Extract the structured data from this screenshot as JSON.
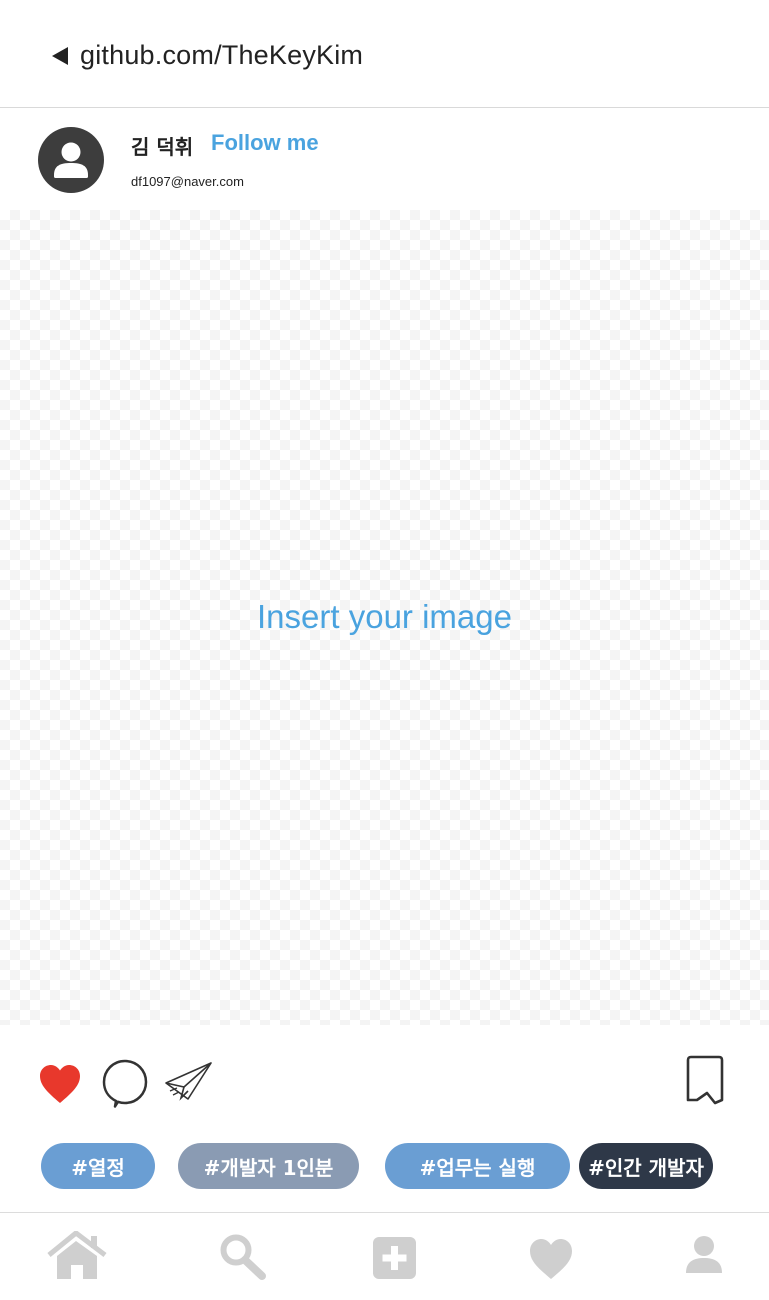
{
  "header": {
    "url": "github.com/TheKeyKim",
    "back_icon": "back-arrow-icon"
  },
  "profile": {
    "name": "김 덕휘",
    "follow_label": "Follow me",
    "email": "df1097@naver.com",
    "avatar_icon": "user-avatar-icon"
  },
  "post": {
    "image_placeholder": "Insert your image"
  },
  "actions": {
    "like_icon": "heart-icon",
    "comment_icon": "comment-icon",
    "share_icon": "paper-plane-icon",
    "bookmark_icon": "bookmark-icon",
    "like_color": "#e8382c"
  },
  "tags": [
    {
      "label": "#열정",
      "color": "#6a9ed3"
    },
    {
      "label": "#개발자 1인분",
      "color": "#8a9bb3"
    },
    {
      "label": "#업무는 실행",
      "color": "#6a9ed3"
    },
    {
      "label": "#인간 개발자",
      "color": "#2e3848"
    }
  ],
  "nav": {
    "items": [
      "home-icon",
      "search-icon",
      "add-icon",
      "heart-icon",
      "profile-icon"
    ],
    "color": "#cfcfcf"
  },
  "colors": {
    "accent": "#4aa3df",
    "text": "#222222"
  }
}
